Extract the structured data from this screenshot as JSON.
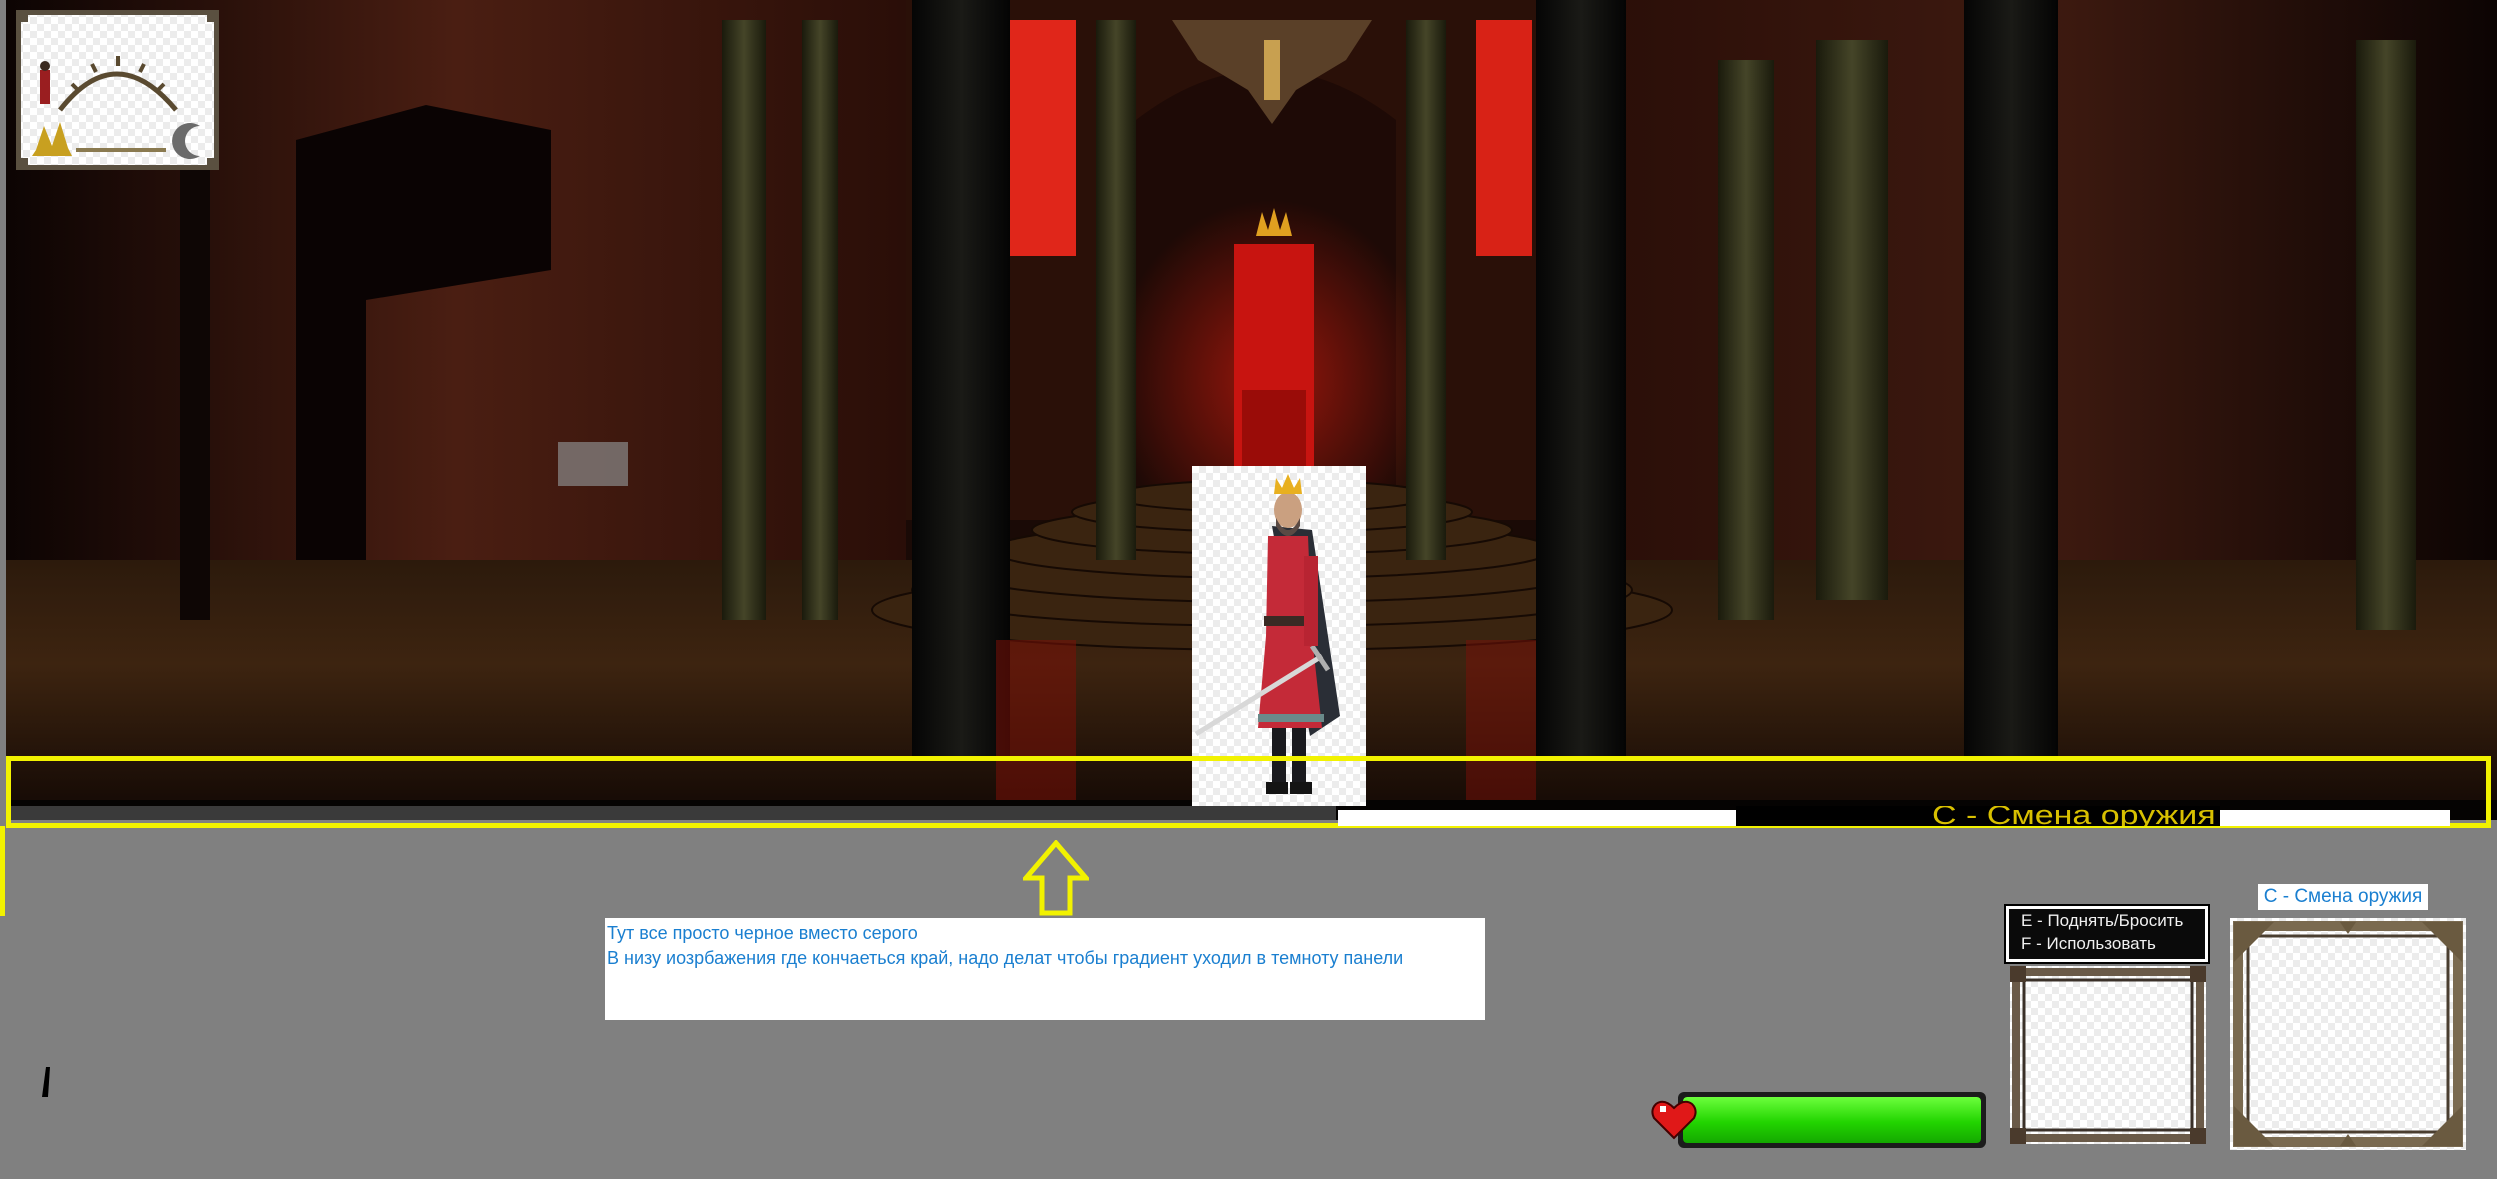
{
  "scene": {
    "name": "throne-hall",
    "colors": {
      "floor": "#2a1408",
      "wall": "#3a1c10",
      "banner": "#e0261a",
      "throne": "#c81410",
      "band": "#f2f200"
    }
  },
  "hud": {
    "strip_text": "C - Смена оружия",
    "note": {
      "line1": "Тут все просто черное вместо серого",
      "line2": "В низу иозрбажения где кончаеться край, надо делат чтобы градиент уходил в темноту панели"
    },
    "health": {
      "fraction": 1.0,
      "color": "#22d400"
    },
    "controls": {
      "line1": "E - Поднять/Бросить",
      "line2": "F - Использовать"
    },
    "weapon_label": "C - Смена оружия",
    "icons": {
      "heart": "heart-icon",
      "daynight": "day-night-icon",
      "arrow": "up-arrow-icon",
      "king": "king-character",
      "moon": "moon-icon",
      "sun": "sun-icon"
    }
  }
}
